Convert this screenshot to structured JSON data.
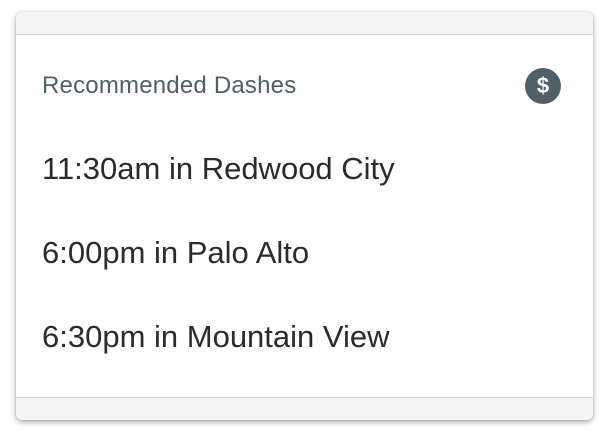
{
  "card": {
    "title": "Recommended Dashes",
    "icon": "dollar-icon",
    "icon_glyph": "$",
    "items": [
      {
        "label": "11:30am in Redwood City"
      },
      {
        "label": "6:00pm in Palo Alto"
      },
      {
        "label": "6:30pm in Mountain View"
      }
    ]
  },
  "colors": {
    "header_text": "#4f5f66",
    "icon_bg": "#4f5f66",
    "item_text": "#2b2b2b",
    "strip_bg": "#f4f4f4"
  }
}
